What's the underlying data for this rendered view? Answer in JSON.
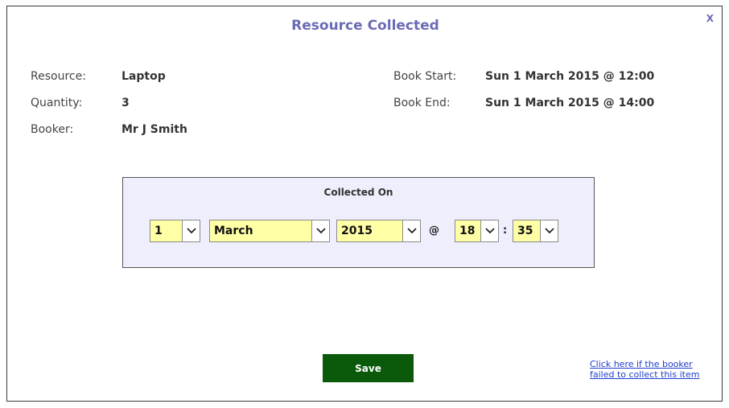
{
  "dialog": {
    "title": "Resource Collected",
    "close_label": "X"
  },
  "details": {
    "resource_label": "Resource:",
    "resource_value": "Laptop",
    "quantity_label": "Quantity:",
    "quantity_value": "3",
    "booker_label": "Booker:",
    "booker_value": "Mr J Smith",
    "book_start_label": "Book Start:",
    "book_start_value": "Sun 1 March 2015 @ 12:00",
    "book_end_label": "Book End:",
    "book_end_value": "Sun 1 March 2015 @ 14:00"
  },
  "collected_on": {
    "title": "Collected On",
    "day": "1",
    "month": "March",
    "year": "2015",
    "at_symbol": "@",
    "hour": "18",
    "colon": ":",
    "minute": "35"
  },
  "actions": {
    "save_label": "Save",
    "fail_link": "Click here if the booker failed to collect this item"
  },
  "colors": {
    "title": "#6b6bb5",
    "save_button_bg": "#0b5a0b",
    "select_bg": "#ffffa6",
    "panel_bg": "#eeeefc",
    "link": "#1f3dcc"
  }
}
